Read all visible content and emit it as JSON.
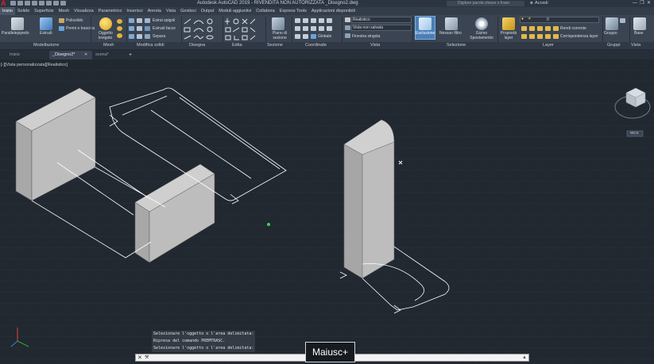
{
  "app": {
    "logo_letter": "A",
    "title": "Autodesk AutoCAD 2019 - RIVENDITA NON AUTORIZZATA    _Disegno2.dwg",
    "search_placeholder": "Digitare parola chiave o frase",
    "user_label": "Accedi"
  },
  "ribbon_tabs": [
    "Inizio",
    "Solido",
    "Superficie",
    "Mesh",
    "Visualizza",
    "Parametrico",
    "Inserisci",
    "Annota",
    "Vista",
    "Gestisci",
    "Output",
    "Moduli aggiuntivi",
    "Collabora",
    "Express Tools",
    "Applicazioni disponibili"
  ],
  "ribbon": {
    "modellazione": {
      "parallelepipedo": "Parallelepipedo",
      "estrudi": "Estrudi",
      "polisolido": "Polisolido",
      "premi_trascina": "Premi e trascina"
    },
    "mesh": {
      "oggetto_levigato": "Oggetto levigato"
    },
    "modifica_solidi": {
      "estrai_spigoli": "Estrai spigoli",
      "estrudi_facce": "Estrudi facce",
      "separa": "Separa"
    },
    "sezione": {
      "piano_sezione": "Piano di sezione"
    },
    "coordinate": {
      "globale": "Globale"
    },
    "vista": {
      "stile_visuale": "Realistico",
      "vista_salvata": "Vista non salvata",
      "finestra": "Finestra singola"
    },
    "selezione": {
      "esclusione": "Esclusione",
      "nessun_filtro": "Nessun filtro",
      "gizmo": "Gizmo Spostamento"
    },
    "layer": {
      "proprieta": "Proprietà layer",
      "layer_value": "0",
      "rendi_corrente": "Rendi corrente",
      "corrispondenza": "Corrispondenza layer"
    },
    "gruppi": {
      "gruppo": "Gruppo"
    },
    "base": {
      "base": "Base"
    }
  },
  "panel_titles": [
    "Modellazione",
    "Mesh",
    "Modifica solidi",
    "Disegna",
    "Edita",
    "Sezione",
    "Coordinate",
    "Vista",
    "Selezione",
    "Layer",
    "Gruppi",
    "Vista"
  ],
  "file_tabs": [
    "Inizio",
    "_Disegno2*",
    "scena*"
  ],
  "viewport": {
    "label": "[-][Vista personalizzata][Realistico]",
    "viewcube_badge": "WCS"
  },
  "command": {
    "history": [
      "Selezionare l'oggetto o l'area delimitata:",
      "Ripresa del comando PREMTRASC.",
      "Selezionare l'oggetto o l'area delimitata:"
    ],
    "prompt": "",
    "key_popup": "Maiusc+"
  },
  "colors": {
    "viewport_bg": "#212830",
    "grid": "#2b3440",
    "solid_light": "#c8c8c8",
    "solid_mid": "#a7a7a7",
    "solid_dark": "#8a8a8a",
    "wire": "#ffffff",
    "accent": "#4a90d9"
  }
}
